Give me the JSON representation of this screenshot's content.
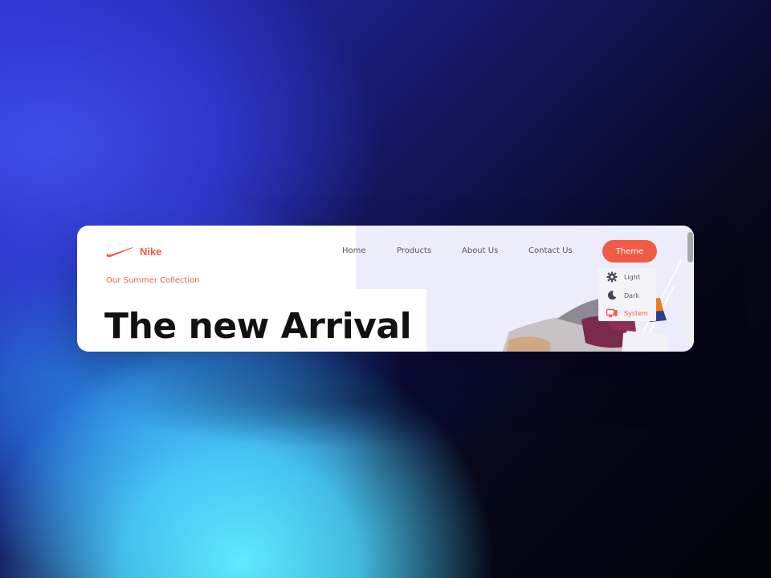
{
  "brand": {
    "name": "Nike",
    "logo_icon": "nike-swoosh-icon",
    "accent_color": "#ef5b43"
  },
  "nav": {
    "items": [
      {
        "label": "Home"
      },
      {
        "label": "Products"
      },
      {
        "label": "About Us"
      },
      {
        "label": "Contact Us"
      }
    ]
  },
  "theme": {
    "button_label": "Theme",
    "menu": [
      {
        "label": "Light",
        "icon": "sun-gear-icon",
        "active": false
      },
      {
        "label": "Dark",
        "icon": "moon-icon",
        "active": false
      },
      {
        "label": "System",
        "icon": "monitor-icon",
        "active": true
      }
    ]
  },
  "hero": {
    "tagline": "Our Summer Collection",
    "headline": "The new Arrival"
  },
  "colors": {
    "panel_background": "#ececfb",
    "headline_text": "#111111",
    "nav_text": "#555566"
  }
}
